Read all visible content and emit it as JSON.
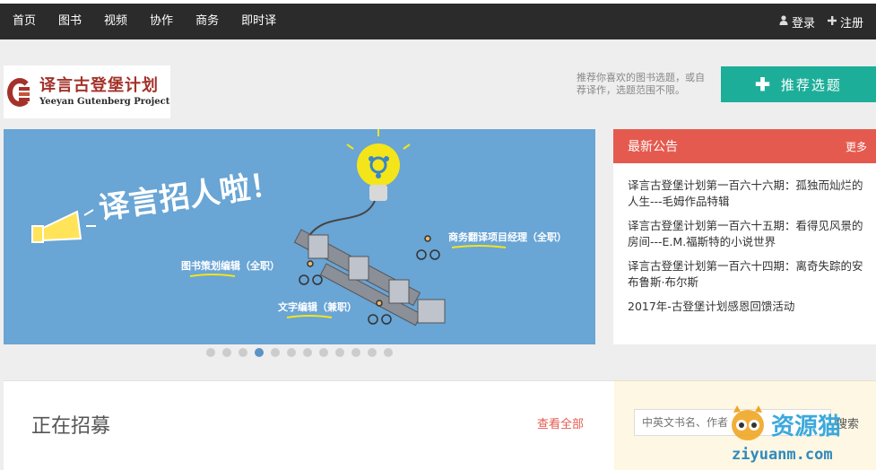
{
  "nav": {
    "items": [
      "首页",
      "图书",
      "视频",
      "协作",
      "商务",
      "即时译"
    ],
    "login": "登录",
    "register": "注册"
  },
  "logo": {
    "cn": "译言古登堡计划",
    "en": "Yeeyan Gutenberg Project"
  },
  "recommend": {
    "hint": "推荐你喜欢的图书选题，或自荐译作，选题范围不限。",
    "button": "推荐选题"
  },
  "banner": {
    "headline": "译言招人啦！",
    "roles": [
      "商务翻译项目经理（全职）",
      "图书策划编辑（全职）",
      "文字编辑（兼职）"
    ],
    "slide_count": 12,
    "active_slide": 4
  },
  "announcements": {
    "title": "最新公告",
    "more": "更多",
    "items": [
      "译言古登堡计划第一百六十六期：孤独而灿烂的人生---毛姆作品特辑",
      "译言古登堡计划第一百六十五期：看得见风景的房间---E.M.福斯特的小说世界",
      "译言古登堡计划第一百六十四期：离奇失踪的安布鲁斯·布尔斯",
      "2017年-古登堡计划感恩回馈活动"
    ]
  },
  "recruiting": {
    "title": "正在招募",
    "view_all": "查看全部"
  },
  "search": {
    "placeholder": "中英文书名、作者",
    "button": "搜索"
  },
  "watermark": {
    "brand": "资源猫",
    "url": "ziyuanm.com"
  },
  "colors": {
    "nav_bg": "#2b2b2b",
    "accent_teal": "#1dae9a",
    "accent_red": "#e55a4e",
    "banner_bg": "#69a5d5",
    "logo_red": "#a4322a"
  }
}
